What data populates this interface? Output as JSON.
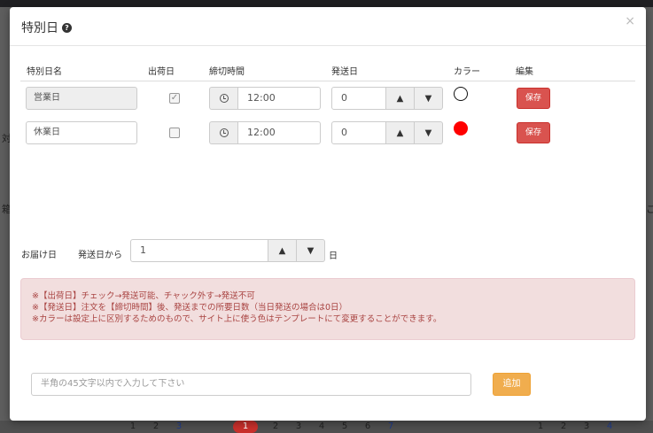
{
  "modal": {
    "title": "特別日",
    "close": "×"
  },
  "table": {
    "headers": [
      "特別日名",
      "出荷日",
      "締切時間",
      "発送日",
      "カラー",
      "編集"
    ],
    "rows": [
      {
        "name": "営業日",
        "name_readonly": true,
        "ship_checked": true,
        "cutoff": "12:00",
        "send_days": "0",
        "color": "#ffffff",
        "save": "保存"
      },
      {
        "name": "休業日",
        "name_readonly": false,
        "ship_checked": false,
        "cutoff": "12:00",
        "send_days": "0",
        "color": "#ff0000",
        "save": "保存"
      }
    ]
  },
  "delivery": {
    "label": "お届け日",
    "from_label": "発送日から",
    "value": "1",
    "suffix": "日"
  },
  "notes": [
    "※【出荷日】チェック→発送可能、チャック外す→発送不可",
    "※【発送日】注文を【締切時間】後、発送までの所要日数（当日発送の場合は0日）",
    "※カラーは設定上に区別するためのもので、サイト上に使う色はテンプレートにて変更することができます。"
  ],
  "footer": {
    "input_placeholder": "半角の45文字以内で入力して下さい",
    "add_label": "追加"
  },
  "background": {
    "pages_left": [
      "1",
      "2",
      "3"
    ],
    "pages_mid": [
      "1",
      "2",
      "3",
      "4",
      "5",
      "6",
      "7"
    ],
    "pages_right": [
      "1",
      "2",
      "3",
      "4"
    ],
    "side_chars": [
      "対",
      "箱",
      "こ"
    ]
  },
  "icons": {
    "up": "▲",
    "down": "▼",
    "check": "✓"
  }
}
